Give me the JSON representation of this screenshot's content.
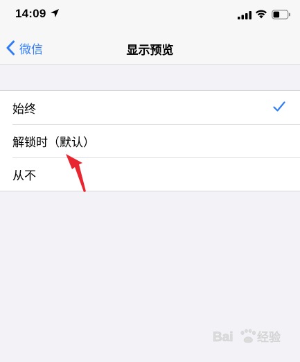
{
  "status_bar": {
    "time": "14:09",
    "icons": [
      "location-arrow-icon",
      "cellular-signal-icon",
      "wifi-icon",
      "battery-icon"
    ]
  },
  "nav_bar": {
    "back_label": "微信",
    "title": "显示预览"
  },
  "options": [
    {
      "label": "始终",
      "selected": true
    },
    {
      "label": "解锁时（默认）",
      "selected": false
    },
    {
      "label": "从不",
      "selected": false
    }
  ],
  "colors": {
    "accent": "#2f7cf6",
    "background": "#f2f2f7",
    "annotation": "#e8262f"
  },
  "watermark": {
    "text": "Baidu经验"
  }
}
